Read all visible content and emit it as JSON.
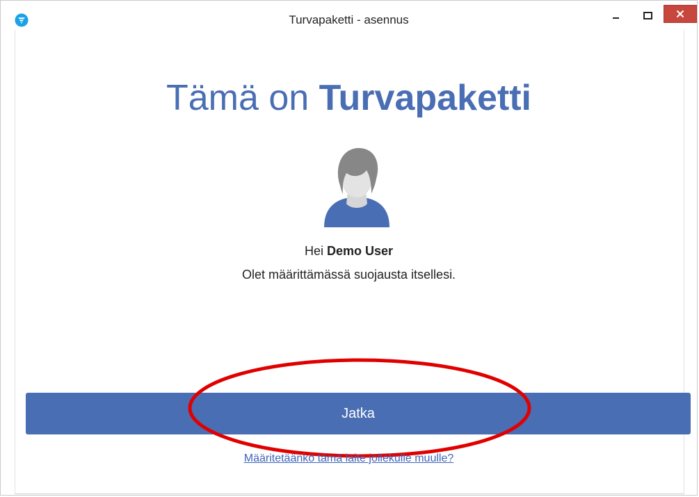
{
  "window": {
    "title": "Turvapaketti - asennus",
    "app_icon": "f-secure-shield-icon",
    "controls": {
      "minimize_icon": "minimize-icon",
      "maximize_icon": "maximize-icon",
      "close_icon": "close-icon",
      "close_color": "#c7463d"
    }
  },
  "main": {
    "headline_regular": "Tämä on ",
    "headline_bold": "Turvapaketti",
    "avatar_icon": "user-avatar-icon",
    "greeting_prefix": "Hei ",
    "user_name": "Demo User",
    "description": "Olet määrittämässä suojausta itsellesi.",
    "continue_label": "Jatka",
    "other_device_link": "Määritetäänkö tämä laite jollekulle muulle?"
  },
  "colors": {
    "accent": "#4a6eb4",
    "link": "#3e63b8",
    "annotation": "#e00000"
  }
}
